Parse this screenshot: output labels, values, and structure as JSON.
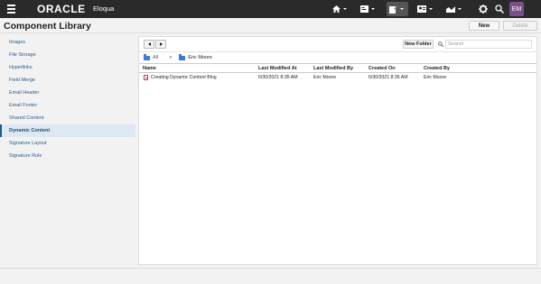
{
  "topbar": {
    "brand": "ORACLE",
    "product": "Eloqua",
    "user_initials": "EM",
    "icons": [
      "menu-icon",
      "home-icon",
      "campaign-icon",
      "assets-icon",
      "contacts-icon",
      "analytics-icon",
      "settings-icon",
      "search-icon"
    ]
  },
  "header": {
    "title": "Component Library",
    "new_label": "New",
    "delete_label": "Delete"
  },
  "sidebar": {
    "items": [
      {
        "label": "Images"
      },
      {
        "label": "File Storage"
      },
      {
        "label": "Hyperlinks"
      },
      {
        "label": "Field Merge"
      },
      {
        "label": "Email Header"
      },
      {
        "label": "Email Footer"
      },
      {
        "label": "Shared Content"
      },
      {
        "label": "Dynamic Content"
      },
      {
        "label": "Signature Layout"
      },
      {
        "label": "Signature Rule"
      }
    ],
    "active": "Dynamic Content"
  },
  "toolbar": {
    "new_folder_label": "New Folder",
    "search_placeholder": "Search"
  },
  "breadcrumb": {
    "root": "All",
    "separator": ">",
    "current": "Eric Moore"
  },
  "table": {
    "columns": [
      "Name",
      "Last Modified At",
      "Last Modified By",
      "Created On",
      "Created By"
    ],
    "rows": [
      {
        "name": "Creating Dynamic Content Blog",
        "last_modified_at": "6/30/2021 8:35 AM",
        "last_modified_by": "Eric Moore",
        "created_on": "6/30/2021 8:35 AM",
        "created_by": "Eric Moore"
      }
    ]
  },
  "colors": {
    "topbar": "#2a2a2a",
    "accent": "#1e5a8f",
    "avatar": "#7b4f8a",
    "folder": "#3c7bd5"
  }
}
